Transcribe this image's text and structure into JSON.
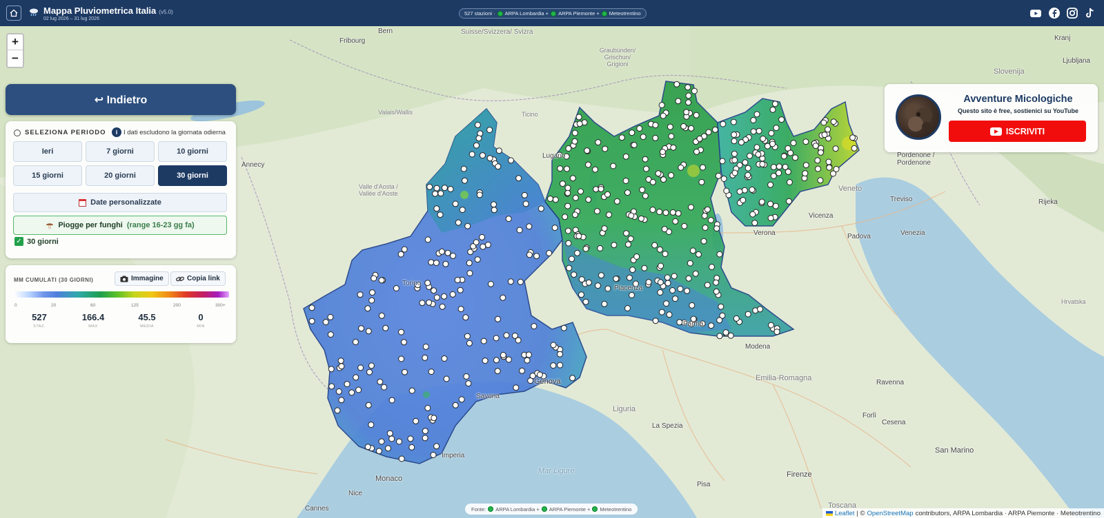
{
  "app": {
    "title": "Mappa Pluviometrica Italia",
    "version": "(v5.0)",
    "date_range": "02 lug 2026 – 31 lug 2026",
    "sources_summary": {
      "stations": "527 stazioni ·",
      "items": [
        "ARPA Lombardia +",
        "ARPA Piemonte +",
        "Meteotrentino"
      ]
    },
    "icons": {
      "home": "home-icon",
      "weather": "cloud-rain-icon",
      "social": [
        "youtube-icon",
        "facebook-icon",
        "instagram-icon",
        "tiktok-icon"
      ]
    }
  },
  "zoom": {
    "in": "+",
    "out": "−"
  },
  "back_button": {
    "label": "↩ Indietro"
  },
  "period": {
    "title": "SELEZIONA PERIODO",
    "info_icon": "i",
    "note": "I dati escludono la giornata odierna",
    "buttons": [
      {
        "label": "Ieri",
        "active": false
      },
      {
        "label": "7 giorni",
        "active": false
      },
      {
        "label": "10 giorni",
        "active": false
      },
      {
        "label": "15 giorni",
        "active": false
      },
      {
        "label": "20 giorni",
        "active": false
      },
      {
        "label": "30 giorni",
        "active": true
      }
    ],
    "custom_label": "Date personalizzate",
    "fungi_label": "Piogge per funghi",
    "fungi_range": "(range 16-23 gg fa)",
    "selected_check": "✓",
    "selected_label": "30 giorni"
  },
  "legend": {
    "title": "MM CUMULATI (30 GIORNI)",
    "image_button": "Immagine",
    "copy_button": "Copia link",
    "ticks": [
      "0",
      "20",
      "60",
      "125",
      "200",
      "300+"
    ],
    "stats": [
      {
        "value": "527",
        "label": "STAZ."
      },
      {
        "value": "166.4",
        "label": "MAX"
      },
      {
        "value": "45.5",
        "label": "MEDIA"
      },
      {
        "value": "0",
        "label": "MIN"
      }
    ]
  },
  "promo": {
    "title": "Avventure Micologiche",
    "subtitle": "Questo sito è free, sostienici su YouTube",
    "button": "ISCRIVITI"
  },
  "footer": {
    "fonte_prefix": "Fonte:",
    "fonte_items": [
      "ARPA Lombardia +",
      "ARPA Piemonte +",
      "Meteotrentino"
    ],
    "attribution": {
      "leaflet": "Leaflet",
      "sep": "| ©",
      "osm": "OpenStreetMap",
      "rest": "contributors, ARPA Lombardia · ARPA Piemonte · Meteotrentino"
    }
  },
  "map_labels": [
    "Suisse/Svizzera/ Svizra",
    "Fribourg",
    "Bern",
    "Valais/Wallis",
    "Ticino",
    "Graubünden/ Grischun/ Grigioni",
    "Lugano",
    "Annecy",
    "Valle d'Aosta / Vallée d'Aoste",
    "Torino",
    "Piacenza",
    "Parma",
    "Modena",
    "Verona",
    "Padova",
    "Venezia",
    "Vicenza",
    "Treviso",
    "Pordenone / Pordenone",
    "Genova",
    "Savona",
    "Imperia",
    "Monaco",
    "Nice",
    "Cannes",
    "Firenze",
    "Ravenna",
    "Forlì",
    "Cesena",
    "San Marino",
    "Pisa",
    "La Spezia",
    "Liguria",
    "Emilia-Romagna",
    "Veneto",
    "Toscana",
    "Mar Ligure",
    "Kranj",
    "Ljubljana",
    "Rijeka",
    "Hrvatska",
    "Slovenija"
  ],
  "colors": {
    "navy": "#1d3a63",
    "accent": "#21b64a",
    "youtube": "#f20d0d"
  }
}
